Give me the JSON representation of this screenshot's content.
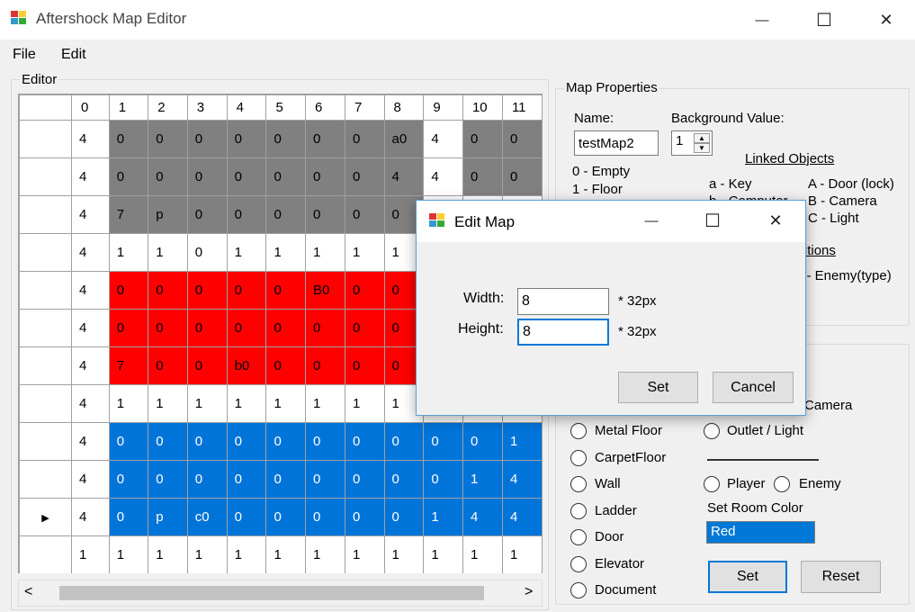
{
  "window": {
    "title": "Aftershock Map Editor",
    "minimize_glyph": "—",
    "maximize_glyph": "☐",
    "close_glyph": "✕"
  },
  "menu": {
    "items": [
      "File",
      "Edit"
    ]
  },
  "editor": {
    "group_label": "Editor",
    "columns": [
      "0",
      "1",
      "2",
      "3",
      "4",
      "5",
      "6",
      "7",
      "8",
      "9",
      "10",
      "11"
    ],
    "selected_row_marker": "▶",
    "rows": [
      {
        "color": "gray",
        "cells": [
          "4",
          "0",
          "0",
          "0",
          "0",
          "0",
          "0",
          "0",
          "a0",
          "4",
          "0",
          "0"
        ]
      },
      {
        "color": "gray",
        "cells": [
          "4",
          "0",
          "0",
          "0",
          "0",
          "0",
          "0",
          "0",
          "4",
          "4",
          "0",
          "0"
        ]
      },
      {
        "color": "gray",
        "cells": [
          "4",
          "7",
          "p",
          "0",
          "0",
          "0",
          "0",
          "0",
          "0",
          "",
          "",
          ""
        ]
      },
      {
        "color": "none",
        "cells": [
          "4",
          "1",
          "1",
          "0",
          "1",
          "1",
          "1",
          "1",
          "1",
          "",
          "",
          ""
        ]
      },
      {
        "color": "red",
        "cells": [
          "4",
          "0",
          "0",
          "0",
          "0",
          "0",
          "B0",
          "0",
          "0",
          "",
          "",
          ""
        ]
      },
      {
        "color": "red",
        "cells": [
          "4",
          "0",
          "0",
          "0",
          "0",
          "0",
          "0",
          "0",
          "0",
          "",
          "",
          ""
        ]
      },
      {
        "color": "red",
        "cells": [
          "4",
          "7",
          "0",
          "0",
          "b0",
          "0",
          "0",
          "0",
          "0",
          "",
          "",
          ""
        ]
      },
      {
        "color": "none",
        "cells": [
          "4",
          "1",
          "1",
          "1",
          "1",
          "1",
          "1",
          "1",
          "1",
          "",
          "",
          ""
        ]
      },
      {
        "color": "blue",
        "cells": [
          "4",
          "0",
          "0",
          "0",
          "0",
          "0",
          "0",
          "0",
          "0",
          "0",
          "0",
          "1"
        ]
      },
      {
        "color": "blue",
        "cells": [
          "4",
          "0",
          "0",
          "0",
          "0",
          "0",
          "0",
          "0",
          "0",
          "0",
          "1",
          "4"
        ]
      },
      {
        "color": "blue",
        "cells": [
          "4",
          "0",
          "p",
          "c0",
          "0",
          "0",
          "0",
          "0",
          "0",
          "1",
          "4",
          "4"
        ]
      },
      {
        "color": "none",
        "cells": [
          "1",
          "1",
          "1",
          "1",
          "1",
          "1",
          "1",
          "1",
          "1",
          "1",
          "1",
          "1"
        ]
      }
    ],
    "selected_row_index": 10,
    "scroll_left_glyph": "<",
    "scroll_right_glyph": ">"
  },
  "map_properties": {
    "group_label": "Map Properties",
    "name_label": "Name:",
    "name_value": "testMap2",
    "background_label": "Background Value:",
    "background_value": "1",
    "tile_legend": [
      "0 - Empty",
      "1 - Floor"
    ],
    "linked_objects_label": "Linked Objects",
    "linked_left": [
      "a - Key",
      "b - Computer"
    ],
    "linked_right": [
      "A - Door (lock)",
      "B - Camera",
      "C - Light"
    ],
    "spawn_label": "Spawn Positions",
    "spawn_right": "# - Enemy(type)"
  },
  "tiles": {
    "partial_camera": "Camera",
    "left_options": [
      "Metal Floor",
      "CarpetFloor",
      "Wall",
      "Ladder",
      "Door",
      "Elevator",
      "Document"
    ],
    "right_option": "Outlet / Light",
    "player_label": "Player",
    "enemy_label": "Enemy",
    "room_color_label": "Set Room Color",
    "room_color_value": "Red",
    "set_label": "Set",
    "reset_label": "Reset"
  },
  "dialog": {
    "title": "Edit Map",
    "width_label": "Width:",
    "width_value": "8",
    "height_label": "Height:",
    "height_value": "8",
    "unit_label": "* 32px",
    "set_label": "Set",
    "cancel_label": "Cancel"
  },
  "colors": {
    "gray": "#808080",
    "red": "#ff0000",
    "blue": "#0074d9",
    "focus": "#0078d7"
  }
}
